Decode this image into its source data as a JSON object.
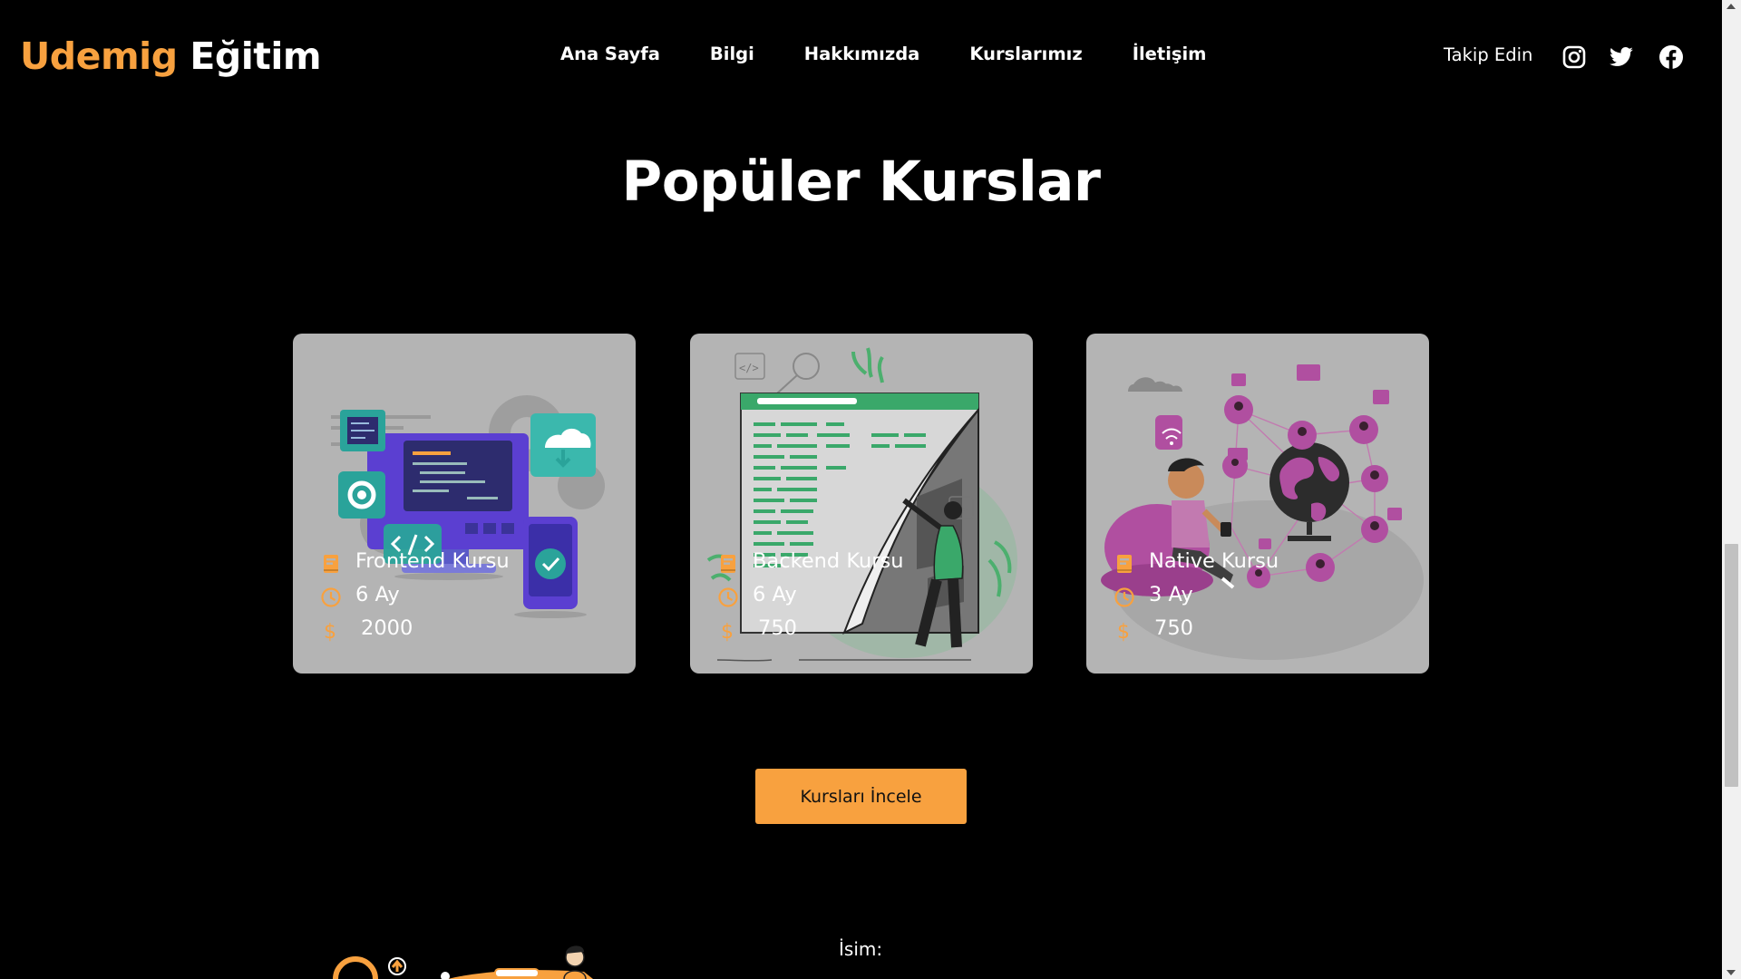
{
  "header": {
    "logo_brand": "Udemig",
    "logo_rest": "Eğitim",
    "nav": [
      "Ana Sayfa",
      "Bilgi",
      "Hakkımızda",
      "Kurslarımız",
      "İletişim"
    ],
    "follow_label": "Takip Edin",
    "social_icons": [
      "instagram-icon",
      "twitter-icon",
      "facebook-icon"
    ]
  },
  "courses_section": {
    "title": "Popüler Kurslar",
    "cards": [
      {
        "name": "Frontend Kursu",
        "duration": "6 Ay",
        "price": "2000",
        "illustration": "frontend-devices-illustration"
      },
      {
        "name": "Backend Kursu",
        "duration": "6 Ay",
        "price": "750",
        "illustration": "backend-code-screen-illustration"
      },
      {
        "name": "Native Kursu",
        "duration": "3 Ay",
        "price": "750",
        "illustration": "network-globe-illustration"
      }
    ],
    "cta_label": "Kursları İncele"
  },
  "contact_section": {
    "name_label": "İsim:"
  },
  "colors": {
    "accent": "#f8a13f",
    "background": "#000000",
    "card": "#b4b4b4",
    "text": "#ffffff"
  }
}
